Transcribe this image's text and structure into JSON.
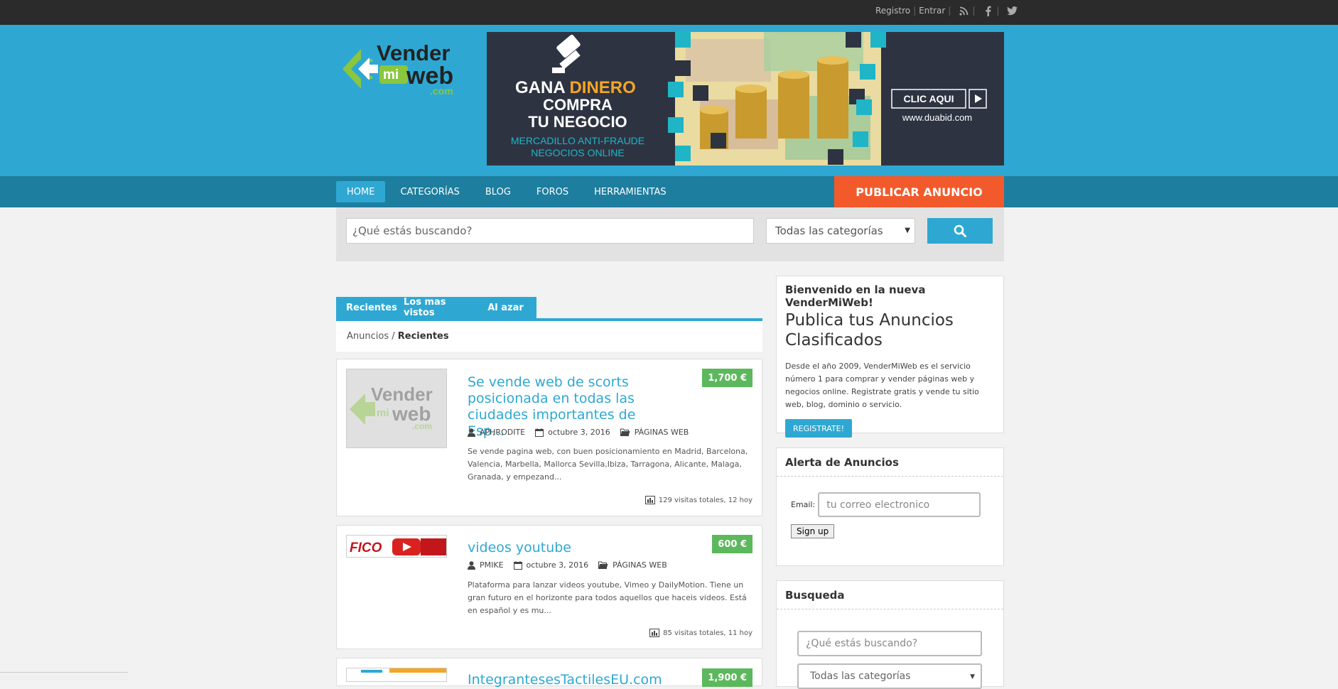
{
  "topbar": {
    "registro": "Registro",
    "entrar": "Entrar",
    "icons": [
      "rss-icon",
      "facebook-icon",
      "twitter-icon"
    ]
  },
  "logo": {
    "line1": "Vender",
    "mi": "mi",
    "web": "web",
    "com": ".com"
  },
  "banner": {
    "line1a": "GANA ",
    "line1b": "DINERO",
    "line2": "COMPRA",
    "line3": "TU NEGOCIO",
    "line4": "MERCADILLO ANTI-FRAUDE",
    "line5": "NEGOCIOS ONLINE",
    "cta": "CLIC AQUI",
    "url": "www.duabid.com"
  },
  "nav": {
    "items": [
      "HOME",
      "CATEGORÍAS",
      "BLOG",
      "FOROS",
      "HERRAMIENTAS"
    ],
    "publish": "PUBLICAR ANUNCIO"
  },
  "search": {
    "placeholder": "¿Qué estás buscando?",
    "category": "Todas las categorías"
  },
  "tabs": [
    "Recientes",
    "Los mas vistos",
    "Al azar"
  ],
  "breadcrumb": {
    "root": "Anuncios",
    "sep": " / ",
    "current": "Recientes"
  },
  "listings": [
    {
      "title": "Se vende web de scorts posicionada en todas las ciudades importantes de Esp...",
      "price": "1,700 €",
      "author": "APHRODITE",
      "date": "octubre 3, 2016",
      "category": "PÁGINAS WEB",
      "desc": "Se vende pagina web, con buen posicionamiento en Madrid, Barcelona, Valencia, Marbella, Mallorca Sevilla,Ibiza, Tarragona, Alicante, Malaga, Granada, y empezand...",
      "visits": "129 visitas totales, 12 hoy"
    },
    {
      "title": "videos youtube",
      "price": "600 €",
      "author": "PMIKE",
      "date": "octubre 3, 2016",
      "category": "PÁGINAS WEB",
      "desc": "Plataforma para lanzar videos youtube, Vimeo y DailyMotion. Tiene un gran futuro en el horizonte para todos aquellos que haceis videos. Está en español y es mu...",
      "visits": "85 visitas totales, 11 hoy",
      "thumb_text": "FICO"
    },
    {
      "title": "IntegrantesesTactilesEU.com",
      "price": "1,900 €"
    }
  ],
  "sidebar": {
    "welcome": {
      "heading": "Bienvenido en la nueva VenderMiWeb!",
      "title": "Publica tus Anuncios Clasificados",
      "desc": "Desde el año 2009, VenderMiWeb es el servicio número 1 para comprar y vender páginas web y negocios online. Registrate gratis y vende tu sitio web, blog, dominio o servicio.",
      "button": "REGISTRATE!"
    },
    "alert": {
      "heading": "Alerta de Anuncios",
      "email_label": "Email:",
      "email_placeholder": "tu correo electronico",
      "button": "Sign up"
    },
    "search": {
      "heading": "Busqueda",
      "placeholder": "¿Qué estás buscando?",
      "category": "Todas las categorías"
    }
  },
  "colors": {
    "brand_blue": "#2ea8d3",
    "nav_dark": "#1d7e9f",
    "publish_orange": "#f25a2c",
    "price_green": "#5cb85c"
  }
}
